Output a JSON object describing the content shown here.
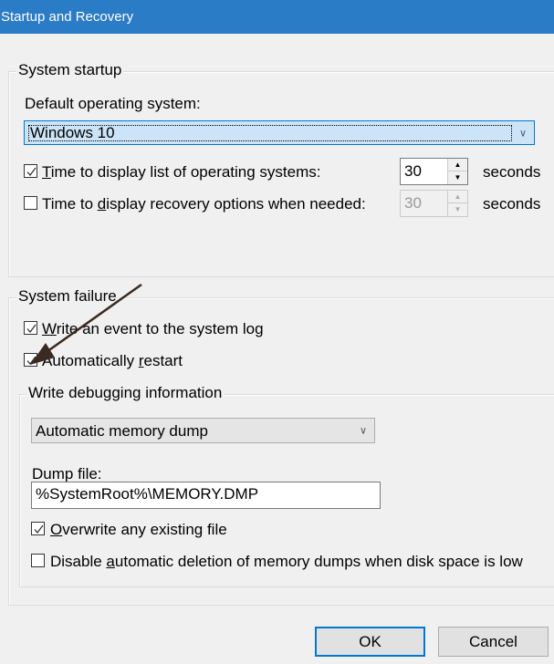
{
  "window": {
    "title": "Startup and Recovery"
  },
  "system_startup": {
    "group_label": "System startup",
    "default_os_label": "Default operating system:",
    "default_os_value": "Windows 10",
    "display_list": {
      "label_pre": "",
      "label_u": "T",
      "label_post": "ime to display list of operating systems:",
      "checked": true,
      "value": "30",
      "unit": "seconds"
    },
    "display_recovery": {
      "label_pre": "Time to ",
      "label_u": "d",
      "label_post": "isplay recovery options when needed:",
      "checked": false,
      "value": "30",
      "unit": "seconds",
      "disabled": true
    }
  },
  "system_failure": {
    "group_label": "System failure",
    "write_event": {
      "label_pre": "",
      "label_u": "W",
      "label_post": "rite an event to the system log",
      "checked": true
    },
    "auto_restart": {
      "label_pre": "Automatically ",
      "label_u": "r",
      "label_post": "estart",
      "checked": true
    },
    "debug": {
      "group_label": "Write debugging information",
      "dump_type": "Automatic memory dump",
      "dump_file_label": "Dump file:",
      "dump_file_value": "%SystemRoot%\\MEMORY.DMP",
      "overwrite": {
        "label_pre": "",
        "label_u": "O",
        "label_post": "verwrite any existing file",
        "checked": true
      },
      "disable_auto_delete": {
        "label_pre": "Disable ",
        "label_u": "a",
        "label_post": "utomatic deletion of memory dumps when disk space is low",
        "checked": false
      }
    }
  },
  "buttons": {
    "ok": "OK",
    "cancel": "Cancel"
  },
  "annotation": {
    "type": "arrow",
    "color": "#3a2a20",
    "points_to": "auto-restart-checkbox"
  }
}
